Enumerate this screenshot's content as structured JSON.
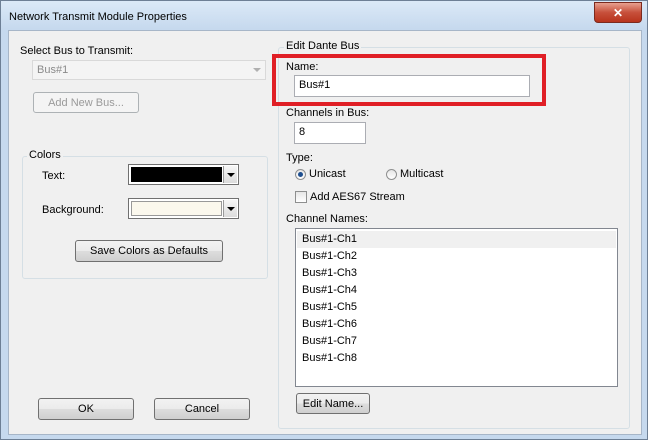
{
  "window": {
    "title": "Network Transmit Module Properties",
    "close_label": "✕"
  },
  "left": {
    "select_bus_label": "Select Bus to Transmit:",
    "select_bus_value": "Bus#1",
    "add_new_bus_label": "Add New Bus...",
    "colors_group_label": "Colors",
    "text_label": "Text:",
    "background_label": "Background:",
    "text_color": "#000000",
    "background_color": "#fbf8ed",
    "save_colors_label": "Save Colors as Defaults"
  },
  "right": {
    "group_label": "Edit Dante Bus",
    "name_label": "Name:",
    "name_value": "Bus#1",
    "channels_label": "Channels in Bus:",
    "channels_value": "8",
    "type_label": "Type:",
    "unicast_label": "Unicast",
    "multicast_label": "Multicast",
    "type_selected": "Unicast",
    "aes67_label": "Add AES67 Stream",
    "aes67_checked": false,
    "channel_names_label": "Channel Names:",
    "channel_names": [
      "Bus#1-Ch1",
      "Bus#1-Ch2",
      "Bus#1-Ch3",
      "Bus#1-Ch4",
      "Bus#1-Ch5",
      "Bus#1-Ch6",
      "Bus#1-Ch7",
      "Bus#1-Ch8"
    ],
    "edit_name_label": "Edit Name..."
  },
  "footer": {
    "ok_label": "OK",
    "cancel_label": "Cancel"
  },
  "colors": {
    "highlight": "#e01f26"
  }
}
